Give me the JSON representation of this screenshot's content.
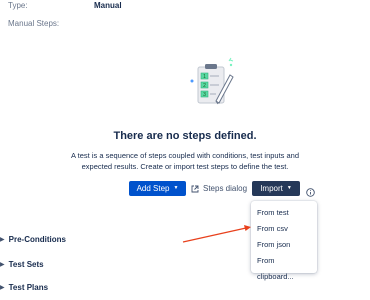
{
  "fields": {
    "type_label": "Type:",
    "type_value": "Manual",
    "manual_steps_label": "Manual Steps:"
  },
  "empty_state": {
    "title": "There are no steps defined.",
    "description": "A test is a sequence of steps coupled with conditions, test inputs and expected results. Create or import test steps to define the test."
  },
  "actions": {
    "add_step": "Add Step",
    "steps_dialog": "Steps dialog",
    "import": "Import"
  },
  "import_menu": {
    "items": [
      "From test",
      "From csv",
      "From json",
      "From clipboard..."
    ]
  },
  "sections": {
    "pre_conditions": "Pre-Conditions",
    "test_sets": "Test Sets",
    "test_plans": "Test Plans"
  },
  "colors": {
    "primary": "#0052cc",
    "dark_button": "#253858",
    "annotation_arrow": "#e8401c"
  }
}
